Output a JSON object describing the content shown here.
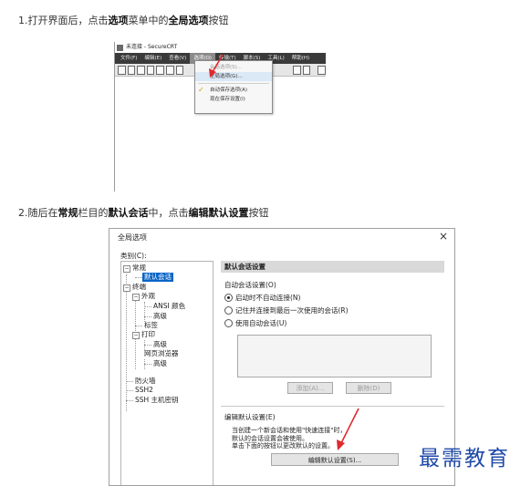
{
  "step1": {
    "prefix": "1.打开界面后，点击",
    "bold1": "选项",
    "mid": "菜单中的",
    "bold2": "全局选项",
    "suffix": "按钮"
  },
  "window1": {
    "title": "未连接 - SecureCRT",
    "menus": [
      "文件(F)",
      "编辑(E)",
      "查看(V)",
      "选项(O)",
      "传输(T)",
      "脚本(S)",
      "工具(L)",
      "帮助(H)"
    ],
    "active_menu_index": 3,
    "dropdown": {
      "items": [
        {
          "label": "会话选项(S)...",
          "disabled": true,
          "checked": false
        },
        {
          "label": "全局选项(G)...",
          "disabled": false,
          "checked": false,
          "highlight": true
        },
        {
          "label": "自动保存选项(A)",
          "disabled": false,
          "checked": true
        },
        {
          "label": "现在保存设置(I)",
          "disabled": false,
          "checked": false
        }
      ]
    }
  },
  "step2": {
    "prefix": "2.随后在",
    "bold1": "常规",
    "mid1": "栏目的",
    "bold2": "默认会话",
    "mid2": "中，点击",
    "bold3": "编辑默认设置",
    "suffix": "按钮"
  },
  "dialog": {
    "title": "全局选项",
    "close": "×",
    "category_label": "类别(C):",
    "tree": {
      "general": "常规",
      "default_session": "默认会话",
      "terminal": "终端",
      "appearance": "外观",
      "ansi_color": "ANSI 颜色",
      "advanced_1": "高级",
      "tabs": "标签",
      "print": "打印",
      "advanced_2": "高级",
      "web_browser": "网页浏览器",
      "advanced_3": "高级",
      "firewall": "防火墙",
      "ssh2": "SSH2",
      "ssh_host_keys": "SSH 主机密钥"
    },
    "panel": {
      "header": "默认会话设置",
      "auto_group_label": "自动会话设置(O)",
      "radio_options": [
        {
          "label": "启动时不自动连接(N)",
          "selected": true
        },
        {
          "label": "记住并连接到最后一次使用的会话(R)",
          "selected": false
        },
        {
          "label": "使用自动会话(U)",
          "selected": false
        }
      ],
      "add_button": "添加(A)...",
      "delete_button": "删除(D)",
      "edit_group_label": "编辑默认设置(E)",
      "edit_desc": [
        "当创建一个新会话和使用\"快速连接\"时，",
        "默认的会话设置会被使用。",
        "单击下面的按钮以更改默认的设置。"
      ],
      "edit_button": "编辑默认设置(S)..."
    }
  },
  "watermark": "最需教育",
  "colors": {
    "arrow": "#e0282e",
    "selection": "#0a64c8",
    "watermark": "#1f4aa8"
  }
}
